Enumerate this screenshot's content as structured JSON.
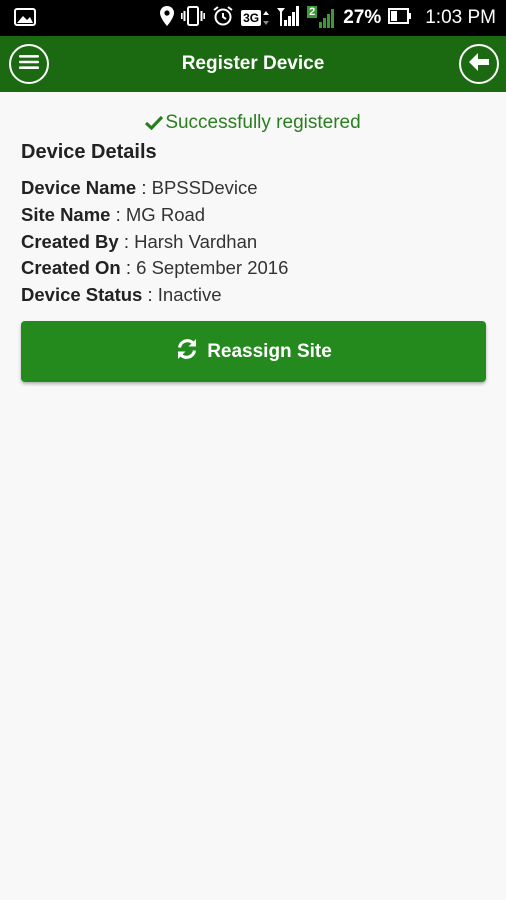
{
  "status_bar": {
    "network_label": "3G",
    "sim_label": "2",
    "battery_percent": "27%",
    "time": "1:03 PM",
    "icons": [
      "gallery-icon",
      "location-icon",
      "vibrate-icon",
      "alarm-icon",
      "signal-icon",
      "battery-icon"
    ]
  },
  "app_bar": {
    "title": "Register Device",
    "menu_icon": "hamburger-menu-icon",
    "back_icon": "arrow-left-icon",
    "color": "#1b6a12"
  },
  "success_message": "Successfully registered",
  "details": {
    "title": "Device Details",
    "rows": [
      {
        "label": "Device Name",
        "value": "BPSSDevice"
      },
      {
        "label": "Site Name",
        "value": "MG Road"
      },
      {
        "label": "Created By",
        "value": "Harsh Vardhan"
      },
      {
        "label": "Created On",
        "value": "6 September 2016"
      },
      {
        "label": "Device Status",
        "value": "Inactive"
      }
    ]
  },
  "reassign_button": {
    "label": "Reassign Site",
    "icon": "refresh-icon",
    "color": "#258a1e"
  }
}
